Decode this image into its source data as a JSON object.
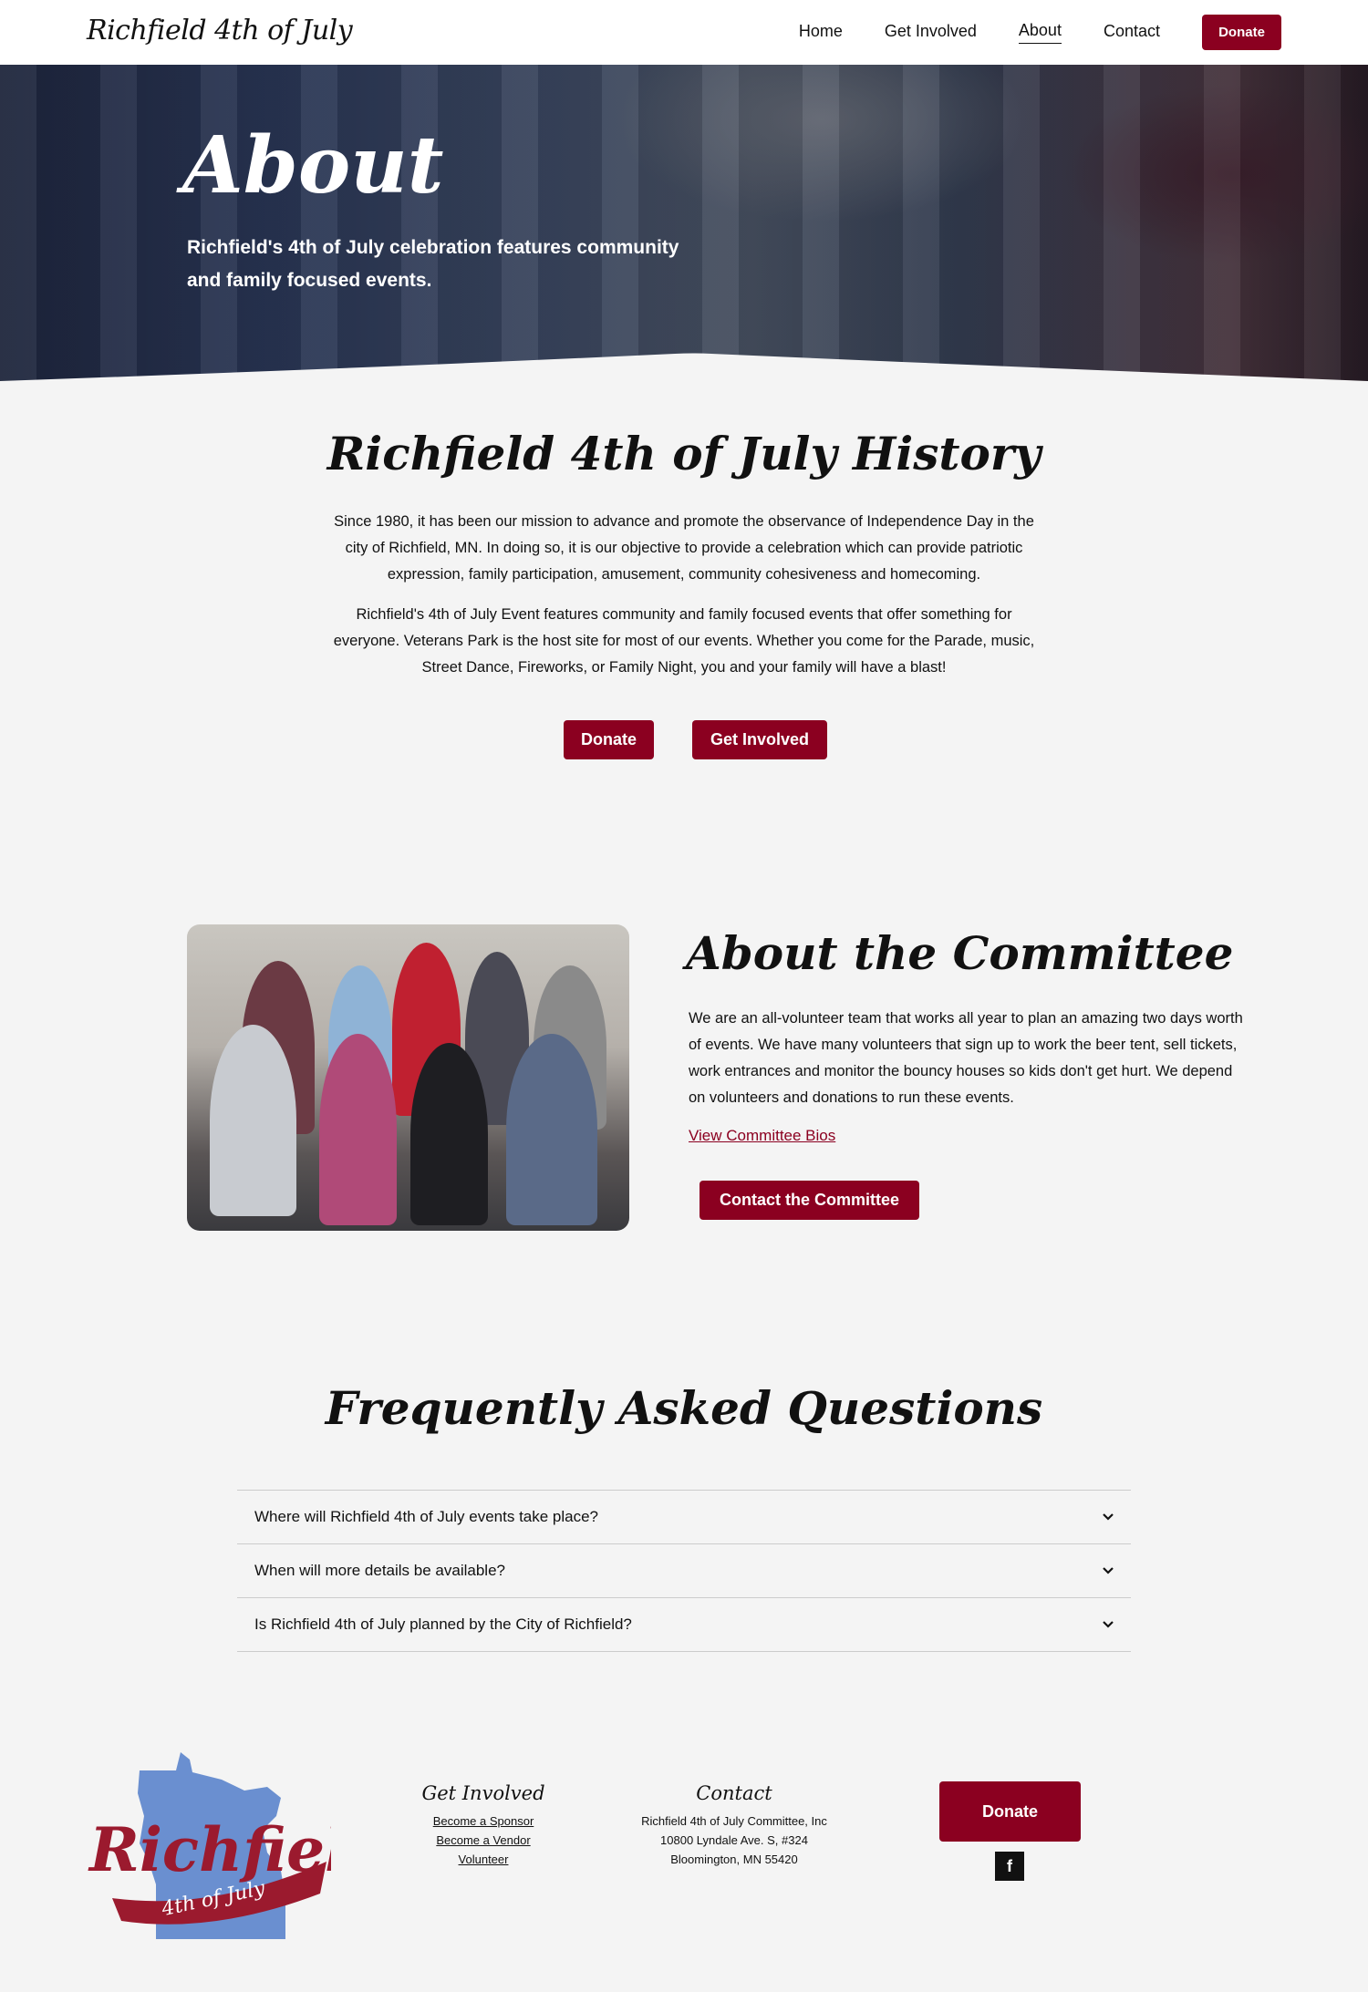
{
  "nav": {
    "brand": "Richfield 4th of July",
    "links": [
      "Home",
      "Get Involved",
      "About",
      "Contact"
    ],
    "donate": "Donate"
  },
  "hero": {
    "title": "About",
    "subtitle": "Richfield's 4th of July celebration features community and family focused events."
  },
  "history": {
    "title": "Richfield 4th of July History",
    "p1": "Since 1980, it has been our mission to advance and promote the observance of Independence Day in the city of Richfield, MN. In doing so, it is our objective to provide a celebration which can provide patriotic expression, family participation, amusement, community cohesiveness and homecoming.",
    "p2": "Richfield's 4th of July Event features community and family focused events that offer something for everyone. Veterans Park is the host site for most of our events. Whether you come for the Parade, music, Street Dance, Fireworks, or Family Night, you and your family will have a blast!",
    "donate": "Donate",
    "get_involved": "Get Involved"
  },
  "committee": {
    "title": "About the Committee",
    "text": "We are an all-volunteer team that works all year to plan an amazing two days worth of events.  We have many volunteers that sign up to work the beer tent, sell tickets, work entrances and monitor the bouncy houses so kids don't get hurt.  We depend on volunteers and donations to run these events.",
    "bios_link": "View Committee Bios",
    "contact_button": "Contact the Committee"
  },
  "faq": {
    "title": "Frequently Asked Questions",
    "items": [
      "Where will Richfield 4th of July events take place?",
      "When will more details be available?",
      "Is Richfield 4th of July planned by the City of Richfield?"
    ]
  },
  "footer": {
    "logo_text": "Richfield",
    "logo_sub": "4th of July",
    "get_involved": {
      "title": "Get Involved",
      "links": [
        "Become a Sponsor",
        "Become a Vendor",
        "Volunteer"
      ]
    },
    "contact": {
      "title": "Contact",
      "lines": [
        "Richfield 4th of July Committee, Inc",
        "10800 Lyndale Ave. S, #324",
        "Bloomington, MN 55420"
      ]
    },
    "donate": "Donate",
    "facebook_icon": "f"
  },
  "colors": {
    "accent": "#8b0020",
    "background": "#f4f4f4",
    "logo_blue": "#6a8fd0"
  },
  "icons": [
    "chevron-down-icon",
    "facebook-icon",
    "minnesota-logo"
  ]
}
